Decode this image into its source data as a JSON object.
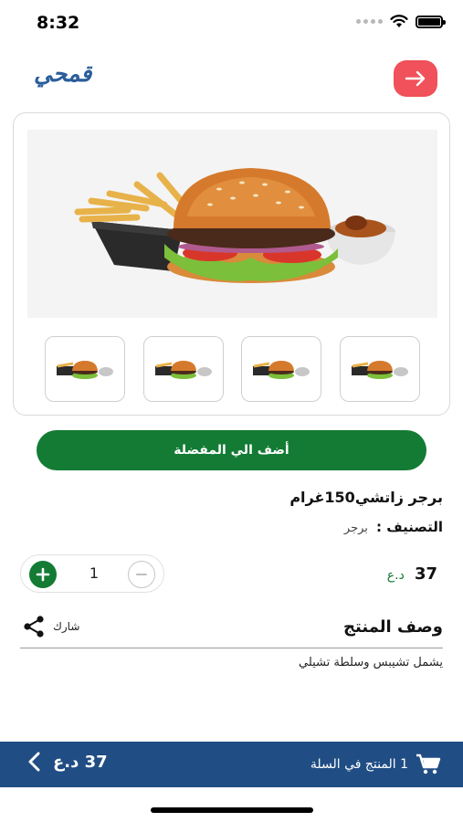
{
  "status_bar": {
    "time": "8:32"
  },
  "header": {
    "logo_text": "قمحي"
  },
  "product": {
    "add_to_favorites_label": "أضف الي المفضلة",
    "name": "برجر زاتشي150غرام",
    "category_label": "التصنيف :",
    "category_value": "برجر",
    "price_value": "37",
    "price_currency": "د.ع",
    "quantity": "1"
  },
  "description": {
    "title": "وصف المنتج",
    "share_label": "شارك",
    "text": "يشمل تشيبس وسلطة تشيلي"
  },
  "cart": {
    "label": "1 المنتج في السلة",
    "total": "37 د.ع"
  },
  "colors": {
    "primary_green": "#137b34",
    "cart_blue": "#204d84",
    "back_red": "#f0515a"
  },
  "icons": [
    "wifi-icon",
    "battery-icon",
    "arrow-right-icon",
    "plus-icon",
    "minus-icon",
    "share-icon",
    "cart-icon",
    "chevron-left-icon"
  ]
}
